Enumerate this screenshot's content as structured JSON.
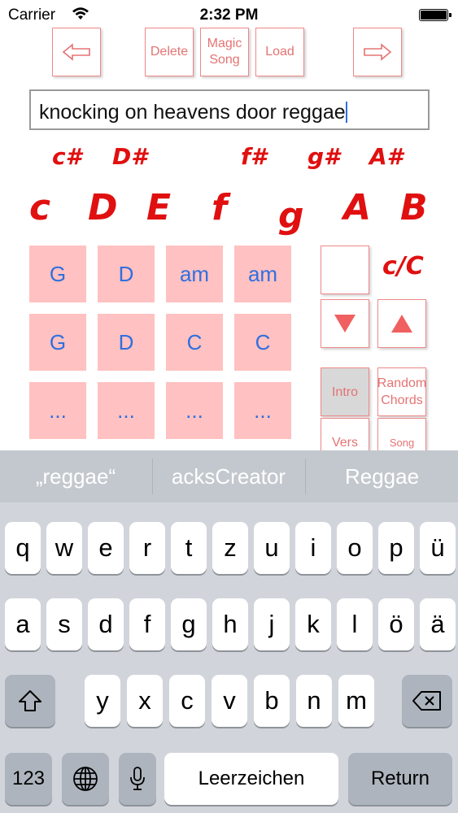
{
  "status_bar": {
    "carrier": "Carrier",
    "time": "2:32 PM"
  },
  "toolbar": {
    "back_icon": "left-arrow-icon",
    "delete_label": "Delete",
    "magic_song_line1": "Magic",
    "magic_song_line2": "Song",
    "load_label": "Load",
    "forward_icon": "right-arrow-icon"
  },
  "search": {
    "value": "knocking on heavens door reggae"
  },
  "notes": {
    "sharps": [
      "c#",
      "D#",
      "f#",
      "g#",
      "A#"
    ],
    "naturals": [
      "c",
      "D",
      "E",
      "f",
      "g",
      "A",
      "B"
    ]
  },
  "chord_grid": {
    "rows": [
      [
        "G",
        "D",
        "am",
        "am"
      ],
      [
        "G",
        "D",
        "C",
        "C"
      ],
      [
        "...",
        "...",
        "...",
        "..."
      ]
    ]
  },
  "side_panel": {
    "key_label": "c/C",
    "down_icon": "down-triangle-icon",
    "up_icon": "up-triangle-icon",
    "intro_label": "Intro",
    "random_line1": "Random",
    "random_line2": "Chords",
    "vers_label": "Vers",
    "song_label": "Song"
  },
  "keyboard": {
    "suggestions": [
      "„reggae“",
      "acksCreator",
      "Reggae"
    ],
    "row1": [
      "q",
      "w",
      "e",
      "r",
      "t",
      "z",
      "u",
      "i",
      "o",
      "p",
      "ü"
    ],
    "row2": [
      "a",
      "s",
      "d",
      "f",
      "g",
      "h",
      "j",
      "k",
      "l",
      "ö",
      "ä"
    ],
    "row3": [
      "y",
      "x",
      "c",
      "v",
      "b",
      "n",
      "m"
    ],
    "numbers_label": "123",
    "space_label": "Leerzeichen",
    "return_label": "Return"
  },
  "colors": {
    "accent_red": "#e01010",
    "chord_bg": "#ffc1c1",
    "chord_text": "#2f6fe0"
  }
}
